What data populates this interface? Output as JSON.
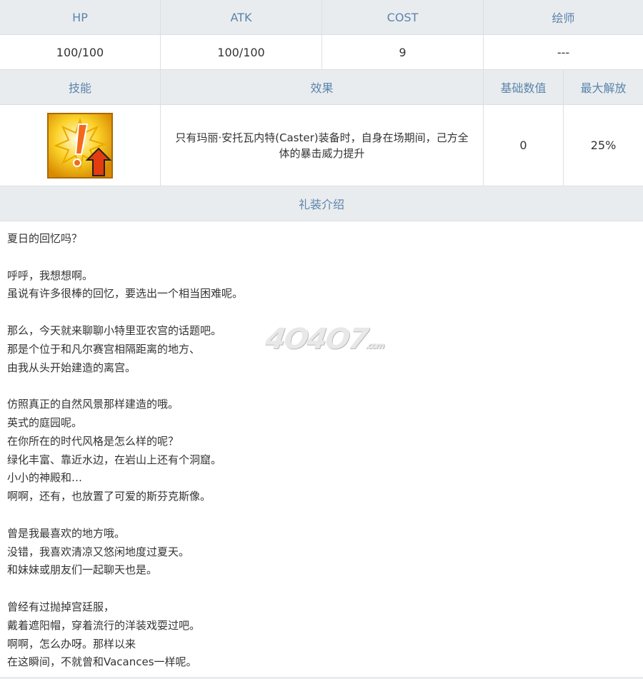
{
  "stats": {
    "headers": [
      "HP",
      "ATK",
      "COST",
      "绘师"
    ],
    "values": [
      "100/100",
      "100/100",
      "9",
      "---"
    ]
  },
  "skill": {
    "headers": [
      "技能",
      "效果",
      "基础数值",
      "最大解放"
    ],
    "icon": "critical-up-icon",
    "effect": "只有玛丽·安托瓦内特(Caster)装备时，自身在场期间，己方全体的暴击威力提升",
    "base_value": "0",
    "max_value": "25%"
  },
  "intro": {
    "header": "礼装介绍",
    "lines": [
      "夏日的回忆吗？",
      "",
      "呼呼，我想想啊。",
      "虽说有许多很棒的回忆，要选出一个相当困难呢。",
      "",
      "那么，今天就来聊聊小特里亚农宫的话题吧。",
      "那是个位于和凡尔赛宫相隔距离的地方、",
      "由我从头开始建造的离宫。",
      "",
      "仿照真正的自然风景那样建造的哦。",
      "英式的庭园呢。",
      "在你所在的时代风格是怎么样的呢？",
      "绿化丰富、靠近水边，在岩山上还有个洞窟。",
      "小小的神殿和…",
      "啊啊，还有，也放置了可爱的斯芬克斯像。",
      "",
      "曾是我最喜欢的地方哦。",
      "没错，我喜欢清凉又悠闲地度过夏天。",
      "和妹妹或朋友们一起聊天也是。",
      "",
      "曾经有过抛掉宫廷服，",
      "戴着遮阳帽，穿着流行的洋装戏耍过吧。",
      "啊啊，怎么办呀。那样以来",
      "在这瞬间，不就曾和Vacances一样呢。"
    ]
  },
  "watermark": "4O4O7.com",
  "colors": {
    "header_bg": "#e9ecee",
    "header_text": "#5b84ad",
    "border": "#dcdfe2"
  }
}
